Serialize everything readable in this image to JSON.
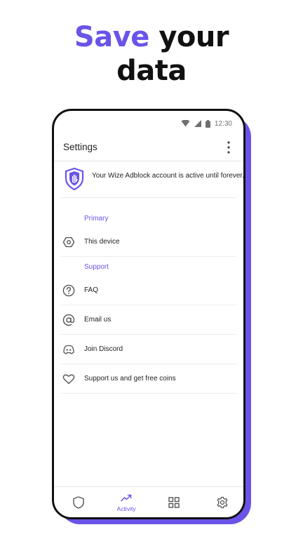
{
  "promo": {
    "headline_accent": "Save",
    "headline_rest": " your",
    "headline_line2": "data"
  },
  "status_bar": {
    "time": "12:30",
    "icons": [
      "wifi-icon",
      "signal-icon",
      "battery-icon"
    ]
  },
  "app_bar": {
    "title": "Settings",
    "menu_icon": "more-vert-icon"
  },
  "account": {
    "icon": "shield-hand-icon",
    "message": "Your Wize Adblock account is active until forever."
  },
  "sections": [
    {
      "label": "Primary",
      "items": [
        {
          "label": "This device",
          "icon": "device-hexagon-icon"
        }
      ]
    },
    {
      "label": "Support",
      "items": [
        {
          "label": "FAQ",
          "icon": "help-circle-icon"
        },
        {
          "label": "Email us",
          "icon": "at-sign-icon"
        },
        {
          "label": "Join Discord",
          "icon": "discord-icon"
        },
        {
          "label": "Support us and get free coins",
          "icon": "heart-icon"
        }
      ]
    }
  ],
  "bottom_nav": [
    {
      "icon": "shield-icon",
      "label": ""
    },
    {
      "icon": "trending-up-icon",
      "label": "Activity",
      "active": true
    },
    {
      "icon": "grid-icon",
      "label": ""
    },
    {
      "icon": "settings-gear-icon",
      "label": ""
    }
  ],
  "colors": {
    "accent": "#6a54e8",
    "text": "#222222",
    "divider": "#ececec",
    "icon_gray": "#555555"
  }
}
